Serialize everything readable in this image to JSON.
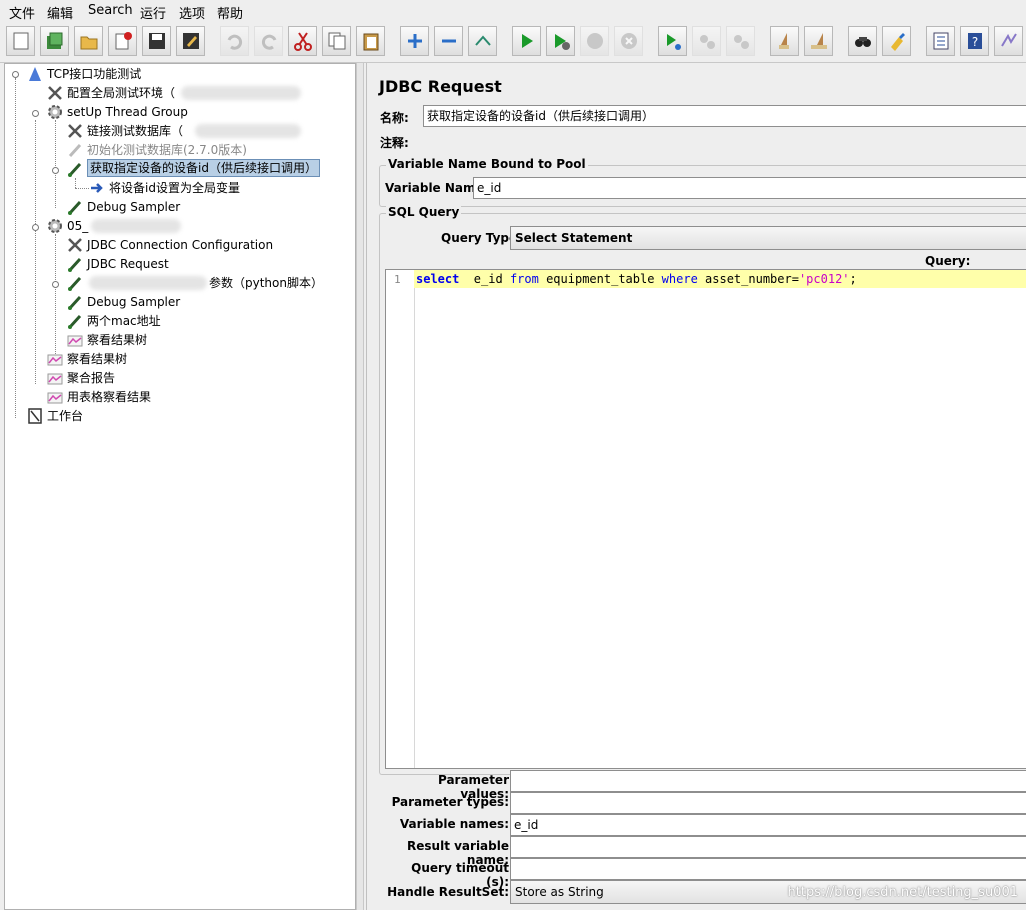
{
  "menu": [
    "文件",
    "编辑",
    "Search",
    "运行",
    "选项",
    "帮助"
  ],
  "toolbar": [
    {
      "icon": "new-icon",
      "tip": "new"
    },
    {
      "icon": "templates-icon",
      "tip": "templates"
    },
    {
      "icon": "open-icon",
      "tip": "open"
    },
    {
      "icon": "close-icon",
      "tip": "close"
    },
    {
      "icon": "save-icon",
      "tip": "save"
    },
    {
      "icon": "save-as-icon",
      "tip": "save-as"
    },
    {
      "icon": "undo-icon",
      "tip": "undo"
    },
    {
      "icon": "redo-icon",
      "tip": "redo"
    },
    {
      "icon": "cut-icon",
      "tip": "cut"
    },
    {
      "icon": "copy-icon",
      "tip": "copy"
    },
    {
      "icon": "paste-icon",
      "tip": "paste"
    },
    {
      "icon": "expand-icon",
      "tip": "expand"
    },
    {
      "icon": "collapse-icon",
      "tip": "collapse"
    },
    {
      "icon": "toggle-icon",
      "tip": "toggle"
    },
    {
      "icon": "start-icon",
      "tip": "start"
    },
    {
      "icon": "start-no-pause-icon",
      "tip": "start-no-pause"
    },
    {
      "icon": "stop-icon",
      "tip": "stop"
    },
    {
      "icon": "shutdown-icon",
      "tip": "shutdown"
    },
    {
      "icon": "remote-start-icon",
      "tip": "remote-start"
    },
    {
      "icon": "remote-stop-icon",
      "tip": "remote-stop"
    },
    {
      "icon": "remote-shutdown-icon",
      "tip": "remote-shutdown"
    },
    {
      "icon": "clear-icon",
      "tip": "clear"
    },
    {
      "icon": "clear-all-icon",
      "tip": "clear-all"
    },
    {
      "icon": "search-icon",
      "tip": "search"
    },
    {
      "icon": "reset-search-icon",
      "tip": "reset-search"
    },
    {
      "icon": "function-helper-icon",
      "tip": "function-helper"
    },
    {
      "icon": "help-icon",
      "tip": "help"
    },
    {
      "icon": "logger-icon",
      "tip": "logger"
    }
  ],
  "tree": [
    {
      "label": "TCP接口功能测试",
      "icon": "testplan-icon"
    },
    {
      "label": "配置全局测试环境（",
      "icon": "config-icon"
    },
    {
      "label": "setUp Thread Group",
      "icon": "gear-icon"
    },
    {
      "label": "链接测试数据库（",
      "icon": "config-icon"
    },
    {
      "label": "初始化测试数据库(2.7.0版本)",
      "icon": "sampler-icon"
    },
    {
      "label": "获取指定设备的设备id（供后续接口调用）",
      "icon": "sampler-icon"
    },
    {
      "label": "将设备id设置为全局变量",
      "icon": "postprocessor-icon"
    },
    {
      "label": "Debug Sampler",
      "icon": "sampler-icon"
    },
    {
      "label": "05_",
      "icon": "gear-icon"
    },
    {
      "label": "JDBC Connection Configuration",
      "icon": "config-icon"
    },
    {
      "label": "JDBC Request",
      "icon": "sampler-icon"
    },
    {
      "label": "参数（python脚本）",
      "icon": "sampler-icon"
    },
    {
      "label": "Debug Sampler",
      "icon": "sampler-icon"
    },
    {
      "label": "两个mac地址",
      "icon": "sampler-icon"
    },
    {
      "label": "察看结果树",
      "icon": "listener-icon"
    },
    {
      "label": "察看结果树",
      "icon": "listener-icon"
    },
    {
      "label": "聚合报告",
      "icon": "listener-icon"
    },
    {
      "label": "用表格察看结果",
      "icon": "listener-icon"
    },
    {
      "label": "工作台",
      "icon": "workbench-icon"
    }
  ],
  "panel": {
    "title": "JDBC Request",
    "name_label": "名称:",
    "name_value": "获取指定设备的设备id（供后续接口调用）",
    "comment_label": "注释:",
    "comment_value": "",
    "pool_group": "Variable Name Bound to Pool",
    "var_name_label": "Variable Name:",
    "var_name_value": "e_id",
    "sql_group": "SQL Query",
    "query_type_label": "Query Type:",
    "query_type_value": "Select Statement",
    "query_label": "Query:",
    "line_number": "1",
    "code": {
      "kw1": "select",
      "col": "  e_id ",
      "kw2": "from",
      "table": " equipment_table ",
      "kw3": "where",
      "cond": " asset_number=",
      "str": "'pc012'",
      "end": ";"
    },
    "params": [
      {
        "label": "Parameter values:",
        "value": ""
      },
      {
        "label": "Parameter types:",
        "value": ""
      },
      {
        "label": "Variable names:",
        "value": "e_id"
      },
      {
        "label": "Result variable name:",
        "value": ""
      },
      {
        "label": "Query timeout (s):",
        "value": ""
      },
      {
        "label": "Handle ResultSet:",
        "value": "Store as String"
      }
    ]
  },
  "watermark": "https://blog.csdn.net/testing_su001"
}
